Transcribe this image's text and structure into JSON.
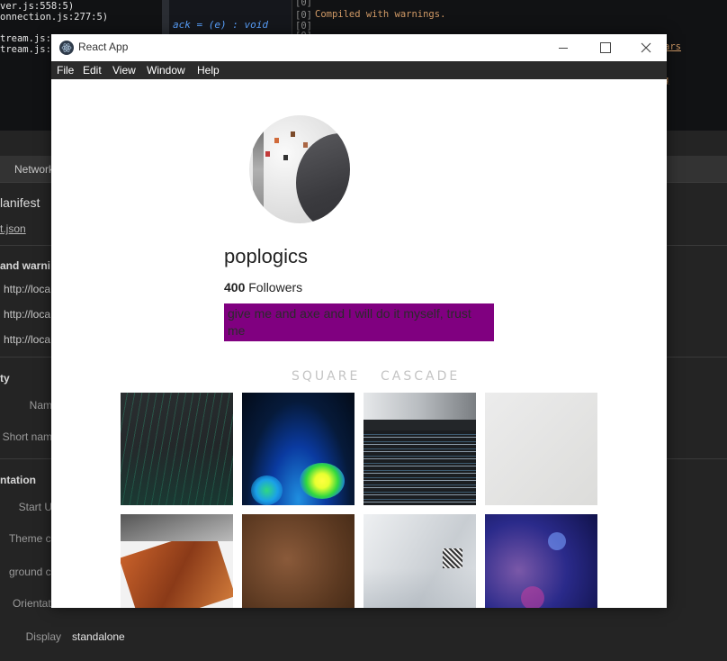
{
  "terminal": {
    "left_lines": [
      "ver.js:558:5)",
      "onnection.js:277:5)",
      "tream.js:14",
      "tream.js:4"
    ],
    "editor_code": "ack = (e) : void",
    "gutter_marks": [
      "[0]",
      "[0]",
      "[0]",
      "[0]"
    ],
    "compiled_message": "Compiled with warnings.",
    "link_fragments": [
      "ars",
      "g"
    ]
  },
  "devtools": {
    "network_tab": "Network",
    "manifest_heading": "lanifest",
    "manifest_link": "t.json",
    "warnings_heading": "and warni",
    "url_rows": [
      "http://loca",
      "http://loca",
      "http://loca"
    ],
    "identity_heading": "ty",
    "name_label": "Nam",
    "short_name_label": "Short nam",
    "presentation_heading": "ntation",
    "start_url_label": "Start U",
    "theme_color_label": "Theme col",
    "background_color_label": "ground col",
    "orientation_label": "Orientatio",
    "display_label": "Display",
    "display_value": "standalone"
  },
  "window": {
    "title": "React App",
    "menu": [
      "File",
      "Edit",
      "View",
      "Window",
      "Help"
    ]
  },
  "profile": {
    "username": "poplogics",
    "followers_count": "400",
    "followers_label": "Followers",
    "bio": "give me and axe and I will do it myself, trust me",
    "bio_background": "#800080"
  },
  "gallery": {
    "tabs": [
      "SQUARE",
      "CASCADE"
    ],
    "images": [
      "dark green code rain",
      "blue green thermal heatmap",
      "monitor with code editor",
      "light grey plain",
      "papers with wood texture",
      "brown leather texture",
      "white fabric closeup",
      "blue purple bokeh"
    ]
  }
}
